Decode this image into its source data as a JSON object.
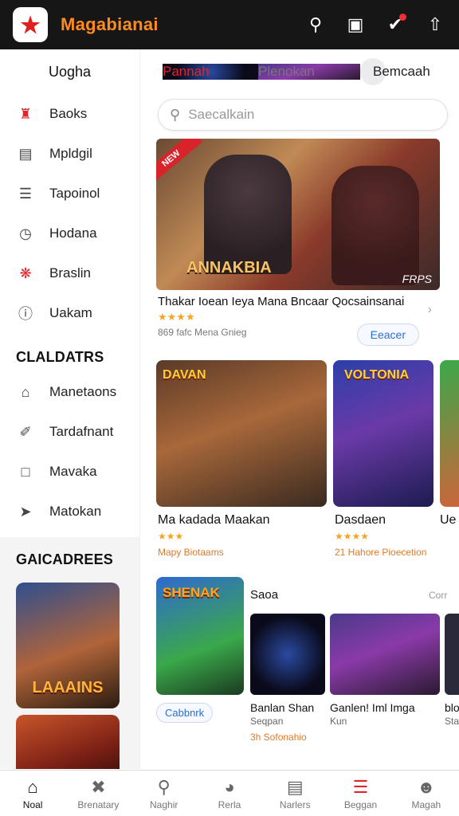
{
  "app": {
    "title": "Magabianai"
  },
  "topbar": {
    "icons": [
      "search-icon",
      "cards-icon",
      "notification-icon",
      "share-icon"
    ]
  },
  "sidebar": {
    "header": "Uogha",
    "items": [
      {
        "label": "Baoks",
        "icon": "crown-icon",
        "active": true
      },
      {
        "label": "Mpldgil",
        "icon": "library-icon"
      },
      {
        "label": "Tapoinol",
        "icon": "list-icon"
      },
      {
        "label": "Hodana",
        "icon": "clock-icon"
      },
      {
        "label": "Braslin",
        "icon": "spiral-icon"
      },
      {
        "label": "Uakam",
        "icon": "info-icon"
      }
    ],
    "section1": "CLALDATRS",
    "section1_items": [
      {
        "label": "Manetaons",
        "icon": "home-icon"
      },
      {
        "label": "Tardafnant",
        "icon": "pin-icon"
      },
      {
        "label": "Mavaka",
        "icon": "square-icon"
      },
      {
        "label": "Matokan",
        "icon": "plane-icon"
      }
    ],
    "section2": "GAICADREES",
    "promo_label": "LAAAINS"
  },
  "main": {
    "tabs": [
      "Pannah",
      "Plenokan",
      "Bemcaah"
    ],
    "search": {
      "placeholder": "Saecalkain"
    },
    "hero": {
      "ribbon": "NEW",
      "logo": "ANNAKBIA",
      "tag": "FRPS",
      "title": "Thakar Ioean Ieya Mana Bncaar Qocsainsanai",
      "rating": "★★★★",
      "meta": "869 fafc Mena Gnieg",
      "button": "Eeacer"
    },
    "row2": [
      {
        "logo": "DAVAN",
        "title": "Ma kadada Maakan",
        "stars": "★★★",
        "meta": "Mapy Biotaams"
      },
      {
        "logo": "VOLTONIA",
        "title": "Dasdaen",
        "stars": "★★★★",
        "meta": "21 Hahore Pioecetion"
      },
      {
        "logo": "",
        "title": "Ue",
        "stars": "",
        "meta": ""
      }
    ],
    "row3": {
      "feature_logo": "SHENAK",
      "title": "Saoa",
      "more": "Corr",
      "chip": "Cabbnrk",
      "thumbs": [
        {
          "title": "Banlan Shan",
          "sub": "Seqpan",
          "meta": "3h Sofonahio"
        },
        {
          "title": "Ganlen! Iml Imga",
          "sub": "Kun",
          "meta": ""
        },
        {
          "title": "blo",
          "sub": "Sta",
          "meta": ""
        }
      ]
    }
  },
  "bottom_nav": [
    {
      "label": "Noal",
      "icon": "home-icon",
      "active": true
    },
    {
      "label": "Brenatary",
      "icon": "cross-icon"
    },
    {
      "label": "Naghir",
      "icon": "search-icon"
    },
    {
      "label": "Rerla",
      "icon": "gauge-icon"
    },
    {
      "label": "Narlers",
      "icon": "calendar-icon"
    },
    {
      "label": "Beggan",
      "icon": "menu-icon"
    },
    {
      "label": "Magah",
      "icon": "profile-icon"
    }
  ]
}
